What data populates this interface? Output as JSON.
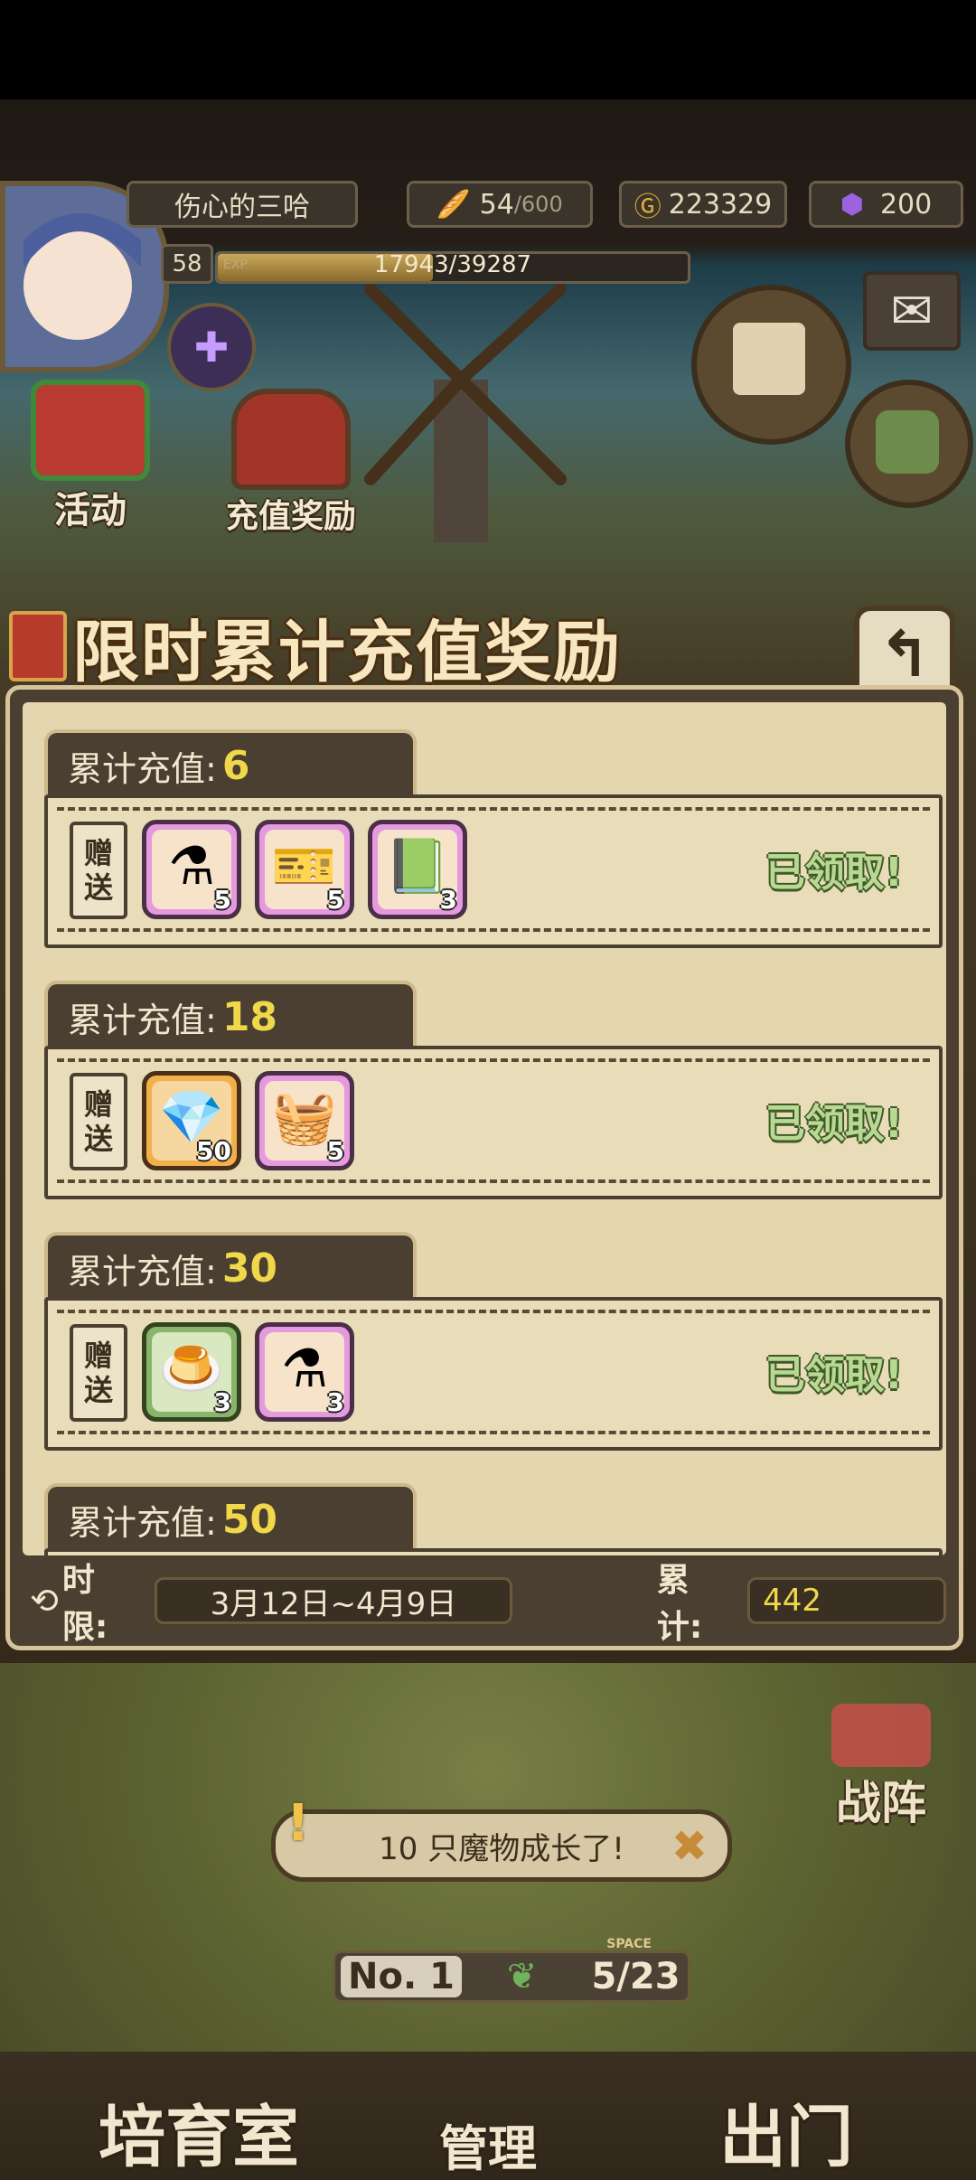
{
  "hud": {
    "player_name": "伤心的三哈",
    "stamina_current": "54",
    "stamina_max": "/600",
    "gold": "223329",
    "gems": "200",
    "level": "58",
    "exp_tag": "EXP",
    "exp_text": "17943/39287",
    "exp_fraction": 0.457
  },
  "side_buttons": {
    "activity": "活动",
    "recharge_reward": "充值奖励"
  },
  "modal": {
    "title": "限时累计充值奖励",
    "back_glyph": "↰",
    "gift_label_top": "赠",
    "gift_label_bottom": "送",
    "tiers": [
      {
        "label": "累计充值:",
        "value": "6",
        "status": "已领取!",
        "items": [
          {
            "icon": "purple-potion-icon",
            "qty": "5",
            "frame": "pink",
            "glyph": "⚗"
          },
          {
            "icon": "ticket-icon",
            "qty": "5",
            "frame": "pink",
            "glyph": "🎫"
          },
          {
            "icon": "rainbow-book-icon",
            "qty": "3",
            "frame": "pink",
            "glyph": "📗"
          }
        ]
      },
      {
        "label": "累计充值:",
        "value": "18",
        "status": "已领取!",
        "items": [
          {
            "icon": "gem-icon",
            "qty": "50",
            "frame": "orange",
            "glyph": "💎"
          },
          {
            "icon": "bread-basket-icon",
            "qty": "5",
            "frame": "pink",
            "glyph": "🧺"
          }
        ]
      },
      {
        "label": "累计充值:",
        "value": "30",
        "status": "已领取!",
        "items": [
          {
            "icon": "pudding-icon",
            "qty": "3",
            "frame": "green",
            "glyph": "🍮"
          },
          {
            "icon": "purple-potion-icon",
            "qty": "3",
            "frame": "pink",
            "glyph": "⚗"
          }
        ]
      },
      {
        "label": "累计充值:",
        "value": "50"
      }
    ],
    "footer": {
      "time_label": "时限:",
      "time_range": "3月12日~4月9日",
      "total_label": "累计:",
      "total_value": "442"
    }
  },
  "toast": {
    "text": "10 只魔物成长了!",
    "close": "✖",
    "bang": "!"
  },
  "battle_label": "战阵",
  "room": {
    "no": "No. 1",
    "space_tag": "SPACE",
    "capacity": "5/23"
  },
  "nav": {
    "nursery": "培育室",
    "manage": "管理",
    "exit": "出门"
  },
  "colors": {
    "modal_frame": "#4a3f30",
    "parchment": "#e9dcb8",
    "claimed_green": "#b8d894",
    "value_yellow": "#f0d84a"
  }
}
